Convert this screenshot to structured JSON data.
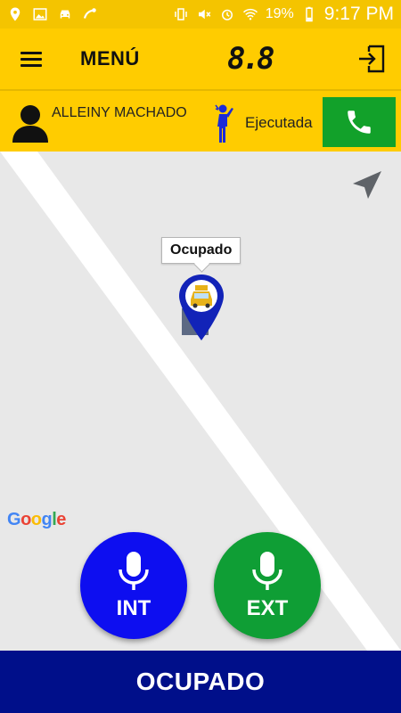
{
  "status_bar": {
    "battery": "19%",
    "time": "9:17 PM",
    "icons": [
      "location-icon",
      "image-icon",
      "car-icon",
      "app-icon",
      "vibrate-icon",
      "mute-icon",
      "alarm-icon",
      "wifi-icon",
      "battery-icon"
    ]
  },
  "toolbar": {
    "title": "MENÚ",
    "counter": "8.8",
    "menu_icon": "hamburger-icon",
    "logout_icon": "logout-icon"
  },
  "info": {
    "driver_name": "ALLEINY MACHADO",
    "status": "Ejecutada",
    "call_icon": "phone-icon"
  },
  "map": {
    "popup_label": "Ocupado",
    "attribution": "Google"
  },
  "buttons": {
    "int_label": "INT",
    "ext_label": "EXT"
  },
  "bottom": {
    "label": "OCUPADO"
  },
  "colors": {
    "toolbar": "#ffcc00",
    "call": "#12a12a",
    "int": "#0d0ef0",
    "ext": "#0f9e35",
    "bottom": "#000f8a"
  }
}
